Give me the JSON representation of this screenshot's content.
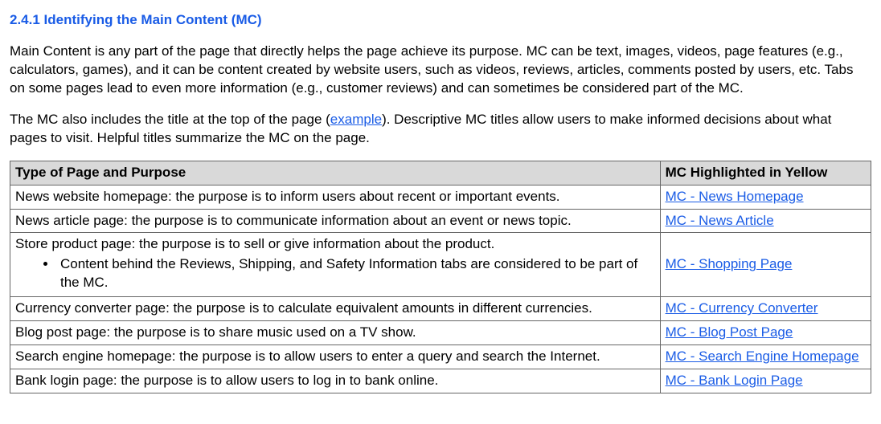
{
  "heading": "2.4.1 Identifying the Main Content (MC)",
  "para1": "Main Content is any part of the page that directly helps the page achieve its purpose.  MC can be text, images, videos, page features (e.g., calculators, games), and it can be content created by website users, such as videos, reviews, articles, comments posted by users, etc.  Tabs on some pages lead to even more information (e.g., customer reviews) and can sometimes be considered part of the MC.",
  "para2": {
    "before": "The MC also includes the title at the top of the page (",
    "link": "example",
    "after": ").  Descriptive MC titles allow users to make informed decisions about what pages to visit.  Helpful titles summarize the MC on the page."
  },
  "table": {
    "head": {
      "col1": "Type of Page and Purpose",
      "col2": "MC Highlighted in Yellow"
    },
    "rows": [
      {
        "type_text": "News website homepage: the purpose is to inform users about recent or important events.",
        "sub_bullet": "",
        "mc_link": "MC - News Homepage"
      },
      {
        "type_text": "News article page: the purpose is to communicate information about an event or news topic.",
        "sub_bullet": "",
        "mc_link": "MC - News Article"
      },
      {
        "type_text": "Store product page: the purpose is to sell or give information about the product.",
        "sub_bullet": "Content behind the Reviews, Shipping, and Safety Information tabs are considered to be part of the MC.",
        "mc_link": "MC - Shopping Page"
      },
      {
        "type_text": "Currency converter page: the purpose is to calculate equivalent amounts in different currencies.",
        "sub_bullet": "",
        "mc_link": "MC - Currency Converter"
      },
      {
        "type_text": "Blog post page: the purpose is to share music used on a TV show.",
        "sub_bullet": "",
        "mc_link": "MC - Blog Post Page"
      },
      {
        "type_text": "Search engine homepage: the purpose is to allow users to enter a query and search the Internet.",
        "sub_bullet": "",
        "mc_link": "MC - Search Engine Homepage"
      },
      {
        "type_text": "Bank login page: the purpose is to allow users to log in to bank online.",
        "sub_bullet": "",
        "mc_link": "MC - Bank Login Page"
      }
    ]
  }
}
